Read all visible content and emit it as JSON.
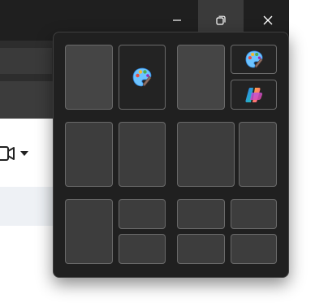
{
  "window": {
    "title_bar_buttons": [
      {
        "name": "minimize",
        "icon": "minimize-icon"
      },
      {
        "name": "restore",
        "icon": "restore-icon"
      },
      {
        "name": "close",
        "icon": "close-icon"
      }
    ]
  },
  "toolbar": {
    "icons": [
      "video-camera-icon",
      "caret-down-icon"
    ]
  },
  "snap_flyout": {
    "layouts": [
      {
        "name": "two-column-equal",
        "zones": [
          "empty",
          "paint-app"
        ]
      },
      {
        "name": "left-with-right-stack",
        "zones": [
          "empty",
          "paint-app",
          "copilot-app"
        ]
      },
      {
        "name": "three-column",
        "zones": [
          "empty",
          "empty"
        ]
      },
      {
        "name": "wide-left-narrow-right",
        "zones": [
          "empty",
          "empty"
        ]
      },
      {
        "name": "left-column-right-stack",
        "zones": [
          "empty",
          "empty",
          "empty"
        ]
      },
      {
        "name": "quad-grid",
        "zones": [
          "empty",
          "empty",
          "empty",
          "empty"
        ]
      }
    ],
    "apps": {
      "paint": {
        "icon": "paint-palette-icon"
      },
      "copilot": {
        "icon": "copilot-icon"
      }
    }
  },
  "colors": {
    "flyout_bg": "#202020",
    "zone_bg": "#3d3d3d",
    "zone_border": "#6a6a6a",
    "titlebar_bg": "#1f1f1f"
  }
}
